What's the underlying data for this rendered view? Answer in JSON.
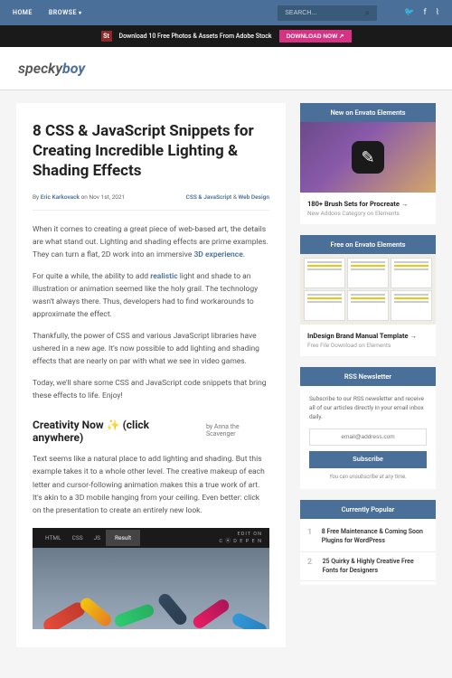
{
  "topbar": {
    "home": "HOME",
    "browse": "BROWSE",
    "search_placeholder": "SEARCH..."
  },
  "promo": {
    "icon": "St",
    "text": "Download 10 Free Photos & Assets From Adobe Stock",
    "cta": "DOWNLOAD NOW ↗"
  },
  "logo": {
    "a": "specky",
    "b": "boy"
  },
  "article": {
    "title": "8 CSS & JavaScript Snippets for Creating Incredible Lighting & Shading Effects",
    "by": "By ",
    "author": "Eric Karkovack",
    "on": " on Nov 1st, 2021",
    "cat1": "CSS & JavaScript",
    "cat2": "Web Design",
    "p1a": "When it comes to creating a great piece of web-based art, the details are what stand out. Lighting and shading effects are prime examples. They can turn a flat, 2D work into an immersive ",
    "p1link": "3D experience",
    "p1b": ".",
    "p2a": "For quite a while, the ability to add ",
    "p2link": "realistic",
    "p2b": " light and shade to an illustration or animation seemed like the holy grail. The technology wasn't always there. Thus, developers had to find workarounds to approximate the effect.",
    "p3": "Thankfully, the power of CSS and various JavaScript libraries have ushered in a new age. It's now possible to add lighting and shading effects that are nearly on par with what we see in video games.",
    "p4": "Today, we'll share some CSS and JavaScript code snippets that bring these effects to life. Enjoy!",
    "h2": "Creativity Now ✨ (click anywhere)",
    "h2by": "by Anna the Scavenger",
    "p5": "Text seems like a natural place to add lighting and shading. But this example takes it to a whole other level. The creative makeup of each letter and cursor-following animation makes this a true work of art. It's akin to a 3D mobile hanging from your ceiling. Even better: click on the presentation to create an entirely new look."
  },
  "embed": {
    "html": "HTML",
    "css": "CSS",
    "js": "JS",
    "result": "Result",
    "edit": "EDIT ON",
    "codepen": "C ⦿ D E P E N"
  },
  "sidebar": {
    "w1h": "New on Envato Elements",
    "w1t": "180+ Brush Sets for Procreate →",
    "w1s": "New Addons Category on Elements",
    "w2h": "Free on Envato Elements",
    "w2t": "InDesign Brand Manual Template →",
    "w2s": "Free File Download on Elements",
    "rssH": "RSS Newsletter",
    "rssText": "Subscribe to our RSS newsletter and receive all of our articles directly in your email inbox daily.",
    "rssPh": "email@address.com",
    "rssBtn": "Subscribe",
    "rssNote": "You can unsubscribe at any time.",
    "popH": "Currently Popular",
    "pop": [
      {
        "n": "1",
        "t": "8 Free Maintenance & Coming Soon Plugins for WordPress"
      },
      {
        "n": "2",
        "t": "25 Quirky & Highly Creative Free Fonts for Designers"
      }
    ]
  }
}
